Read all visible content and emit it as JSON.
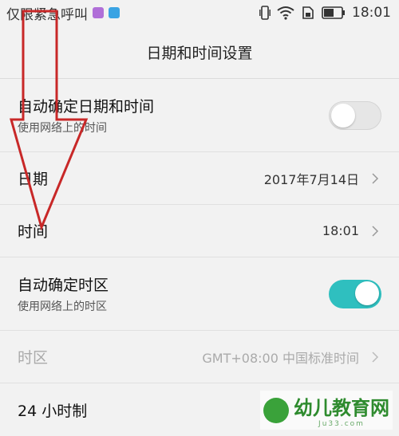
{
  "status_bar": {
    "carrier": "仅限紧急呼叫",
    "time": "18:01"
  },
  "title": "日期和时间设置",
  "rows": {
    "auto_datetime": {
      "label": "自动确定日期和时间",
      "sub": "使用网络上的时间",
      "toggle": "off"
    },
    "date": {
      "label": "日期",
      "value": "2017年7月14日"
    },
    "time": {
      "label": "时间",
      "value": "18:01"
    },
    "auto_timezone": {
      "label": "自动确定时区",
      "sub": "使用网络上的时区",
      "toggle": "on"
    },
    "timezone": {
      "label": "时区",
      "value": "GMT+08:00 中国标准时间"
    },
    "hour24": {
      "label": "24 小时制"
    }
  },
  "watermark": {
    "text": "幼儿教育网",
    "sub": "Ju33.com"
  },
  "colors": {
    "accent": "#2fbfbf",
    "arrow": "#c82828"
  }
}
